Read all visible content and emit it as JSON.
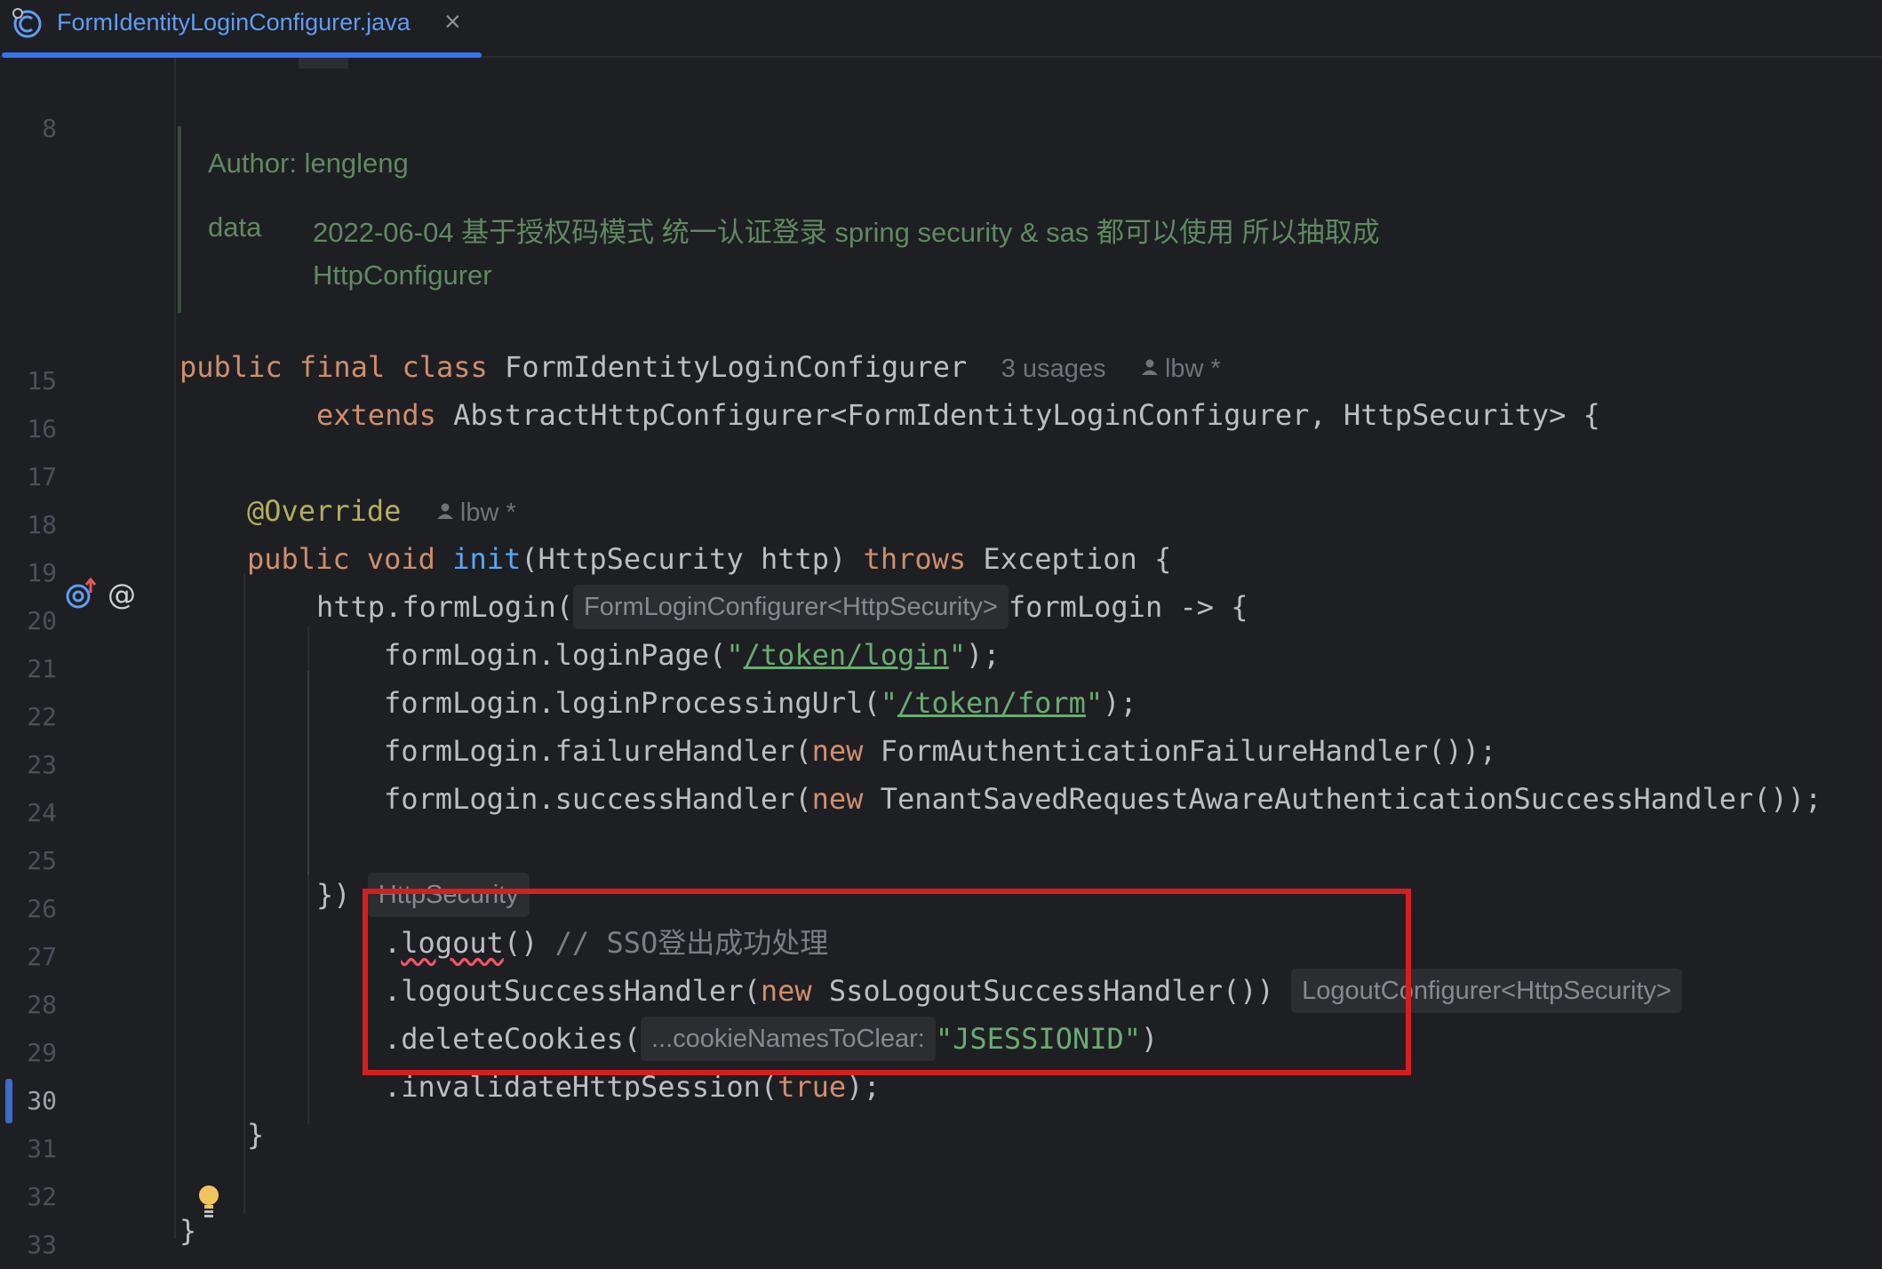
{
  "tab": {
    "filename": "FormIdentityLoginConfigurer.java",
    "close_symbol": "×"
  },
  "line_numbers": [
    "8",
    "15",
    "16",
    "17",
    "18",
    "19",
    "20",
    "21",
    "22",
    "23",
    "24",
    "25",
    "26",
    "27",
    "28",
    "29",
    "30",
    "31",
    "32",
    "33"
  ],
  "doc": {
    "author": "Author: lengleng",
    "data_tag": "data",
    "data_text": "2022-06-04 基于授权码模式 统一认证登录 spring security & sas 都可以使用 所以抽取成 HttpConfigurer"
  },
  "code": {
    "l15_public": "public",
    "l15_final": "final",
    "l15_class": "class",
    "l15_name": "FormIdentityLoginConfigurer",
    "l15_usages": "3 usages",
    "l15_author": "lbw *",
    "l16_extends": "extends",
    "l16_rest": "AbstractHttpConfigurer<FormIdentityLoginConfigurer, HttpSecurity> {",
    "l18_ann": "@Override",
    "l18_author": "lbw *",
    "l19_public": "public",
    "l19_void": "void",
    "l19_init": "init",
    "l19_params": "(HttpSecurity http)",
    "l19_throws": "throws",
    "l19_rest": "Exception {",
    "l20_pre": "http.formLogin(",
    "l20_hint": "FormLoginConfigurer<HttpSecurity>",
    "l20_post": "formLogin -> {",
    "l21_pre": "formLogin.loginPage(",
    "l21_q1": "\"",
    "l21_str": "/token/login",
    "l21_q2": "\"",
    "l21_post": ");",
    "l22_pre": "formLogin.loginProcessingUrl(",
    "l22_q1": "\"",
    "l22_str": "/token/form",
    "l22_q2": "\"",
    "l22_post": ");",
    "l23_pre": "formLogin.failureHandler(",
    "l23_new": "new",
    "l23_post": "FormAuthenticationFailureHandler());",
    "l24_pre": "formLogin.successHandler(",
    "l24_new": "new",
    "l24_post": "TenantSavedRequestAwareAuthenticationSuccessHandler());",
    "l26_pre": "})",
    "l26_hint": "HttpSecurity",
    "l27_dot": ".",
    "l27_fn": "logout",
    "l27_paren": "()",
    "l27_comment": "// SSO登出成功处理",
    "l28_pre": ".logoutSuccessHandler(",
    "l28_new": "new",
    "l28_post": "SsoLogoutSuccessHandler())",
    "l28_hint": "LogoutConfigurer<HttpSecurity>",
    "l29_pre": ".deleteCookies(",
    "l29_hint": "...cookieNamesToClear:",
    "l29_str": "\"JSESSIONID\"",
    "l29_post": ")",
    "l30_pre": ".invalidateHttpSession(",
    "l30_true": "true",
    "l30_post": ");",
    "l31": "}",
    "l33": "}"
  },
  "colors": {
    "background": "#1e1f22",
    "keyword": "#cf8e6d",
    "function": "#56a8f5",
    "annotation": "#b3ae60",
    "string": "#6aab73",
    "highlight_box": "#d71e1e",
    "tab_accent": "#3574f0"
  },
  "icons": [
    "java-class-icon",
    "close-icon",
    "user-icon",
    "override-method-icon",
    "annotation-at-icon",
    "lightbulb-icon"
  ]
}
